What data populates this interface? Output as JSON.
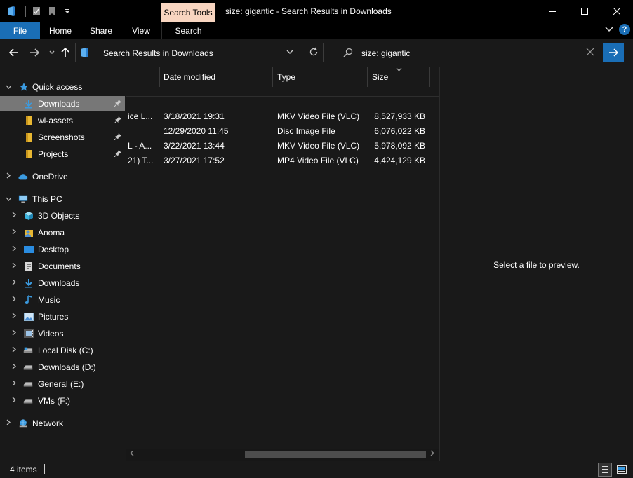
{
  "window": {
    "title": "size: gigantic - Search Results in Downloads",
    "contextual_tab": "Search Tools"
  },
  "ribbon": {
    "tabs": [
      {
        "label": "File"
      },
      {
        "label": "Home"
      },
      {
        "label": "Share"
      },
      {
        "label": "View"
      },
      {
        "label": "Search"
      }
    ]
  },
  "address": {
    "path": "Search Results in Downloads"
  },
  "search": {
    "query": "size: gigantic"
  },
  "nav": {
    "quick_access": "Quick access",
    "quick_items": [
      {
        "label": "Downloads",
        "icon": "download-arrow-icon",
        "selected": true
      },
      {
        "label": "wl-assets",
        "icon": "folder-icon"
      },
      {
        "label": "Screenshots",
        "icon": "folder-icon"
      },
      {
        "label": "Projects",
        "icon": "folder-icon"
      }
    ],
    "onedrive": "OneDrive",
    "this_pc": "This PC",
    "pc_items": [
      {
        "label": "3D Objects",
        "icon": "cube-icon"
      },
      {
        "label": "Anoma",
        "icon": "user-folder-icon"
      },
      {
        "label": "Desktop",
        "icon": "desktop-icon"
      },
      {
        "label": "Documents",
        "icon": "document-icon"
      },
      {
        "label": "Downloads",
        "icon": "download-arrow-icon"
      },
      {
        "label": "Music",
        "icon": "music-note-icon"
      },
      {
        "label": "Pictures",
        "icon": "picture-icon"
      },
      {
        "label": "Videos",
        "icon": "film-icon"
      },
      {
        "label": "Local Disk (C:)",
        "icon": "drive-icon"
      },
      {
        "label": "Downloads (D:)",
        "icon": "drive-icon"
      },
      {
        "label": "General (E:)",
        "icon": "drive-icon"
      },
      {
        "label": "VMs (F:)",
        "icon": "drive-icon"
      }
    ],
    "network": "Network"
  },
  "list": {
    "columns": {
      "date": "Date modified",
      "type": "Type",
      "size": "Size"
    },
    "rows": [
      {
        "name": "ice L...",
        "date": "3/18/2021 19:31",
        "type": "MKV Video File (VLC)",
        "size": "8,527,933 KB"
      },
      {
        "name": "",
        "date": "12/29/2020 11:45",
        "type": "Disc Image File",
        "size": "6,076,022 KB"
      },
      {
        "name": "L - A...",
        "date": "3/22/2021 13:44",
        "type": "MKV Video File (VLC)",
        "size": "5,978,092 KB"
      },
      {
        "name": "21) T...",
        "date": "3/27/2021 17:52",
        "type": "MP4 Video File (VLC)",
        "size": "4,424,129 KB"
      }
    ]
  },
  "preview": {
    "message": "Select a file to preview."
  },
  "status": {
    "item_count": "4 items"
  },
  "colors": {
    "accent": "#1a6eb6",
    "contextual_tab": "#f8d5c0",
    "background": "#191919",
    "selected": "#777777"
  }
}
